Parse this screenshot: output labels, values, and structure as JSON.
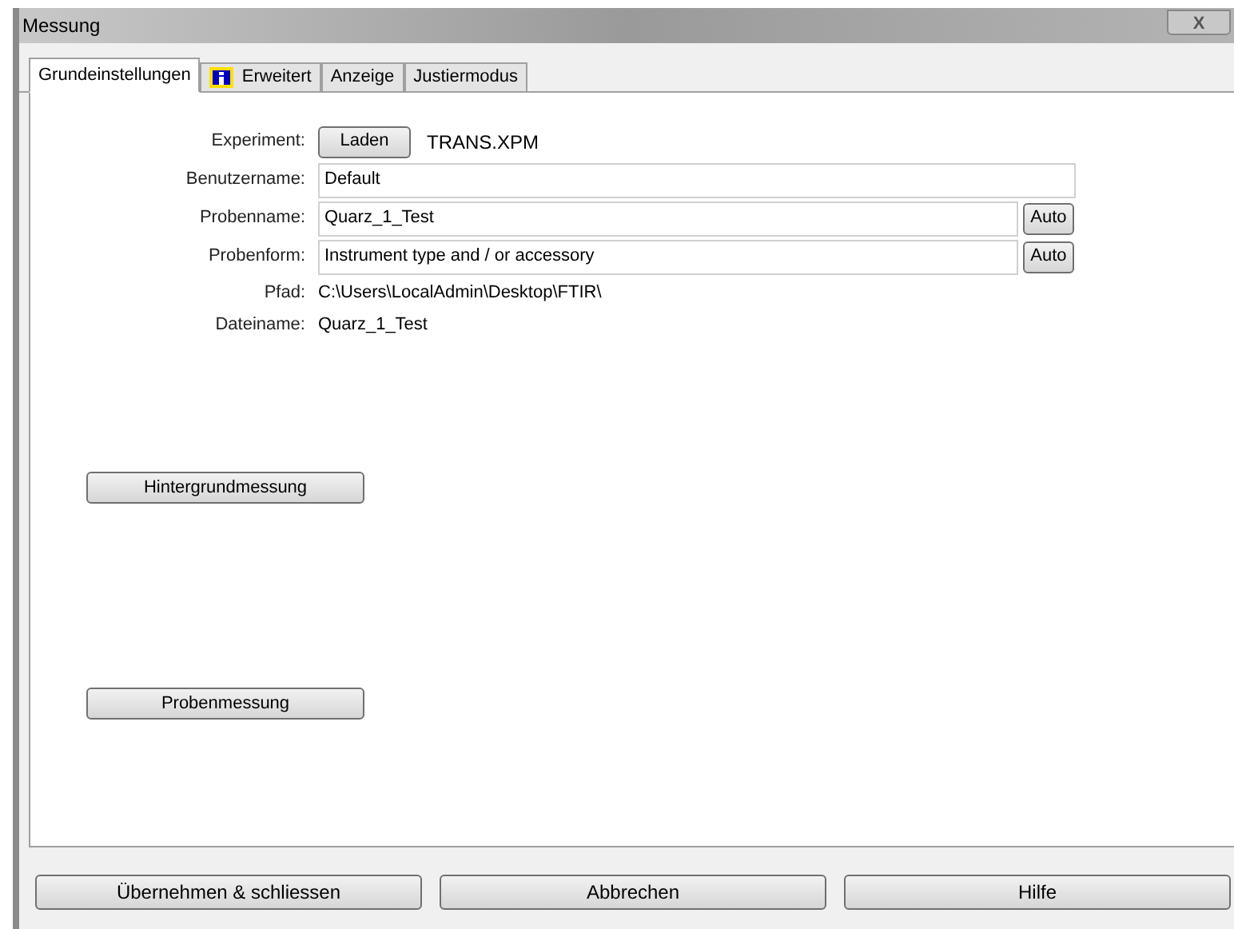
{
  "window": {
    "title": "Messung",
    "close": "X"
  },
  "tabs": [
    {
      "label": "Grundeinstellungen",
      "selected": true,
      "kind": "text"
    },
    {
      "label": "Erweitert",
      "selected": false,
      "kind": "info"
    },
    {
      "label": "Anzeige",
      "selected": false,
      "kind": "text"
    },
    {
      "label": "Justiermodus",
      "selected": false,
      "kind": "text"
    }
  ],
  "form": [
    {
      "kind": "button",
      "label": "Experiment:",
      "button": "Laden",
      "value": "TRANS.XPM"
    },
    {
      "kind": "field",
      "label": "Benutzername:",
      "value": "Default"
    },
    {
      "kind": "field",
      "label": "Probenname:",
      "value": "Quarz_1_Test",
      "button": "Auto"
    },
    {
      "kind": "field",
      "label": "Probenform:",
      "value": "Instrument type and / or accessory",
      "button": "Auto"
    },
    {
      "kind": "text",
      "label": "Pfad:",
      "value": "C:\\Users\\LocalAdmin\\Desktop\\FTIR\\"
    },
    {
      "kind": "text",
      "label": "Dateiname:",
      "value": "Quarz_1_Test"
    }
  ],
  "actions": [
    "Hintergrundmessung",
    "Probenmessung"
  ],
  "buttons": [
    "Übernehmen & schliessen",
    "Abbrechen",
    "Hilfe"
  ]
}
